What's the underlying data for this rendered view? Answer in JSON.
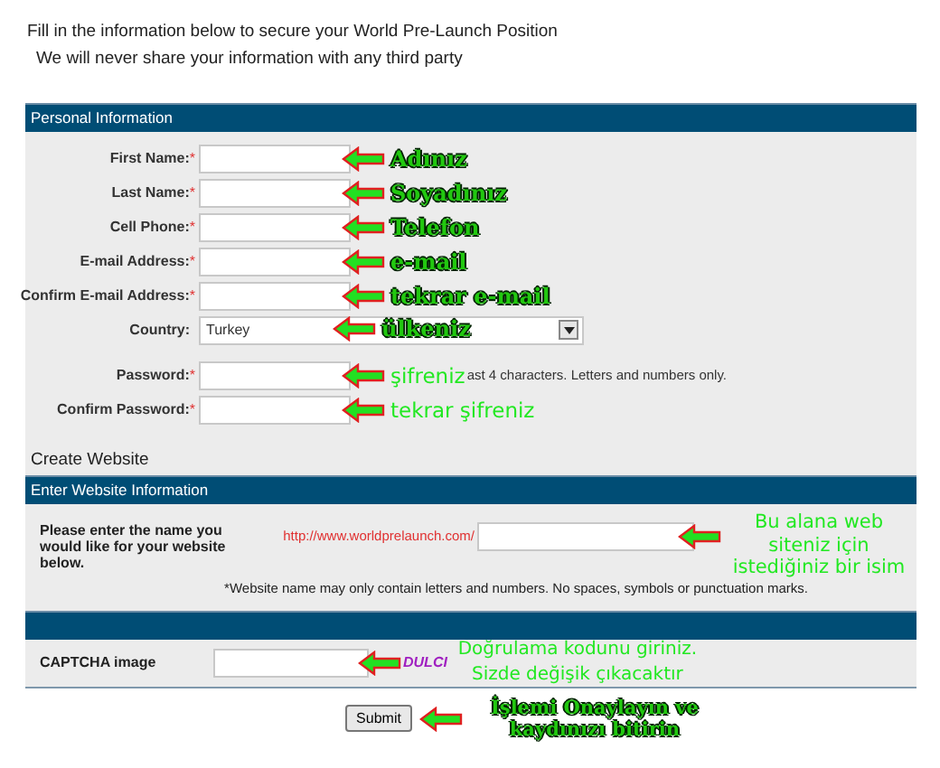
{
  "intro": [
    "Fill in the information below to secure your World Pre-Launch Position",
    "We will never share your information with any third party"
  ],
  "personal": {
    "header": "Personal Information",
    "fields": [
      {
        "label": "First Name:",
        "required_mark": "*",
        "kind": "text",
        "annotation": {
          "text": "Adınız",
          "kind": "outlined"
        }
      },
      {
        "label": "Last Name:",
        "required_mark": "*",
        "kind": "text",
        "annotation": {
          "text": "Soyadınız",
          "kind": "outlined"
        }
      },
      {
        "label": "Cell Phone:",
        "required_mark": "*",
        "kind": "text",
        "annotation": {
          "text": "Telefon",
          "kind": "outlined"
        }
      },
      {
        "label": "E-mail Address:",
        "required_mark": "*",
        "kind": "text",
        "annotation": {
          "text": "e-mail",
          "kind": "outlined"
        }
      },
      {
        "label": "Confirm E-mail Address:",
        "required_mark": "*",
        "kind": "text",
        "annotation": {
          "text": "tekrar e-mail",
          "kind": "outlined"
        }
      },
      {
        "label": "Country:",
        "kind": "select",
        "value": "Turkey",
        "annotation": {
          "text": "ülkeniz",
          "kind": "outlined"
        }
      },
      {
        "label": "Password:",
        "required_mark": "*",
        "kind": "text",
        "annotation": {
          "text": "şifreniz",
          "kind": "plain"
        },
        "hint": "ast 4 characters. Letters and numbers only."
      },
      {
        "label": "Confirm Password:",
        "required_mark": "*",
        "kind": "text",
        "annotation": {
          "text": "tekrar şifreniz",
          "kind": "plain"
        }
      }
    ]
  },
  "create_website": "Create Website",
  "website": {
    "header": "Enter Website Information",
    "label": "Please enter the name you would like for your website below.",
    "prefix": "http://www.worldprelaunch.com/",
    "annotation": {
      "text": "Bu alana web siteniz  için istediğiniz bir isim",
      "kind": "plain"
    },
    "note": "*Website name may only contain letters and numbers. No spaces, symbols or punctuation marks."
  },
  "captcha": {
    "label": "CAPTCHA image",
    "image_text": "DULCI",
    "annotation": {
      "text": "Doğrulama kodunu giriniz. Sizde değişik çıkacaktır",
      "kind": "plain"
    }
  },
  "submit": {
    "label": "Submit",
    "annotation": {
      "text": "İşlemi Onaylayın ve kaydınızı bitirin",
      "kind": "outlined"
    }
  }
}
